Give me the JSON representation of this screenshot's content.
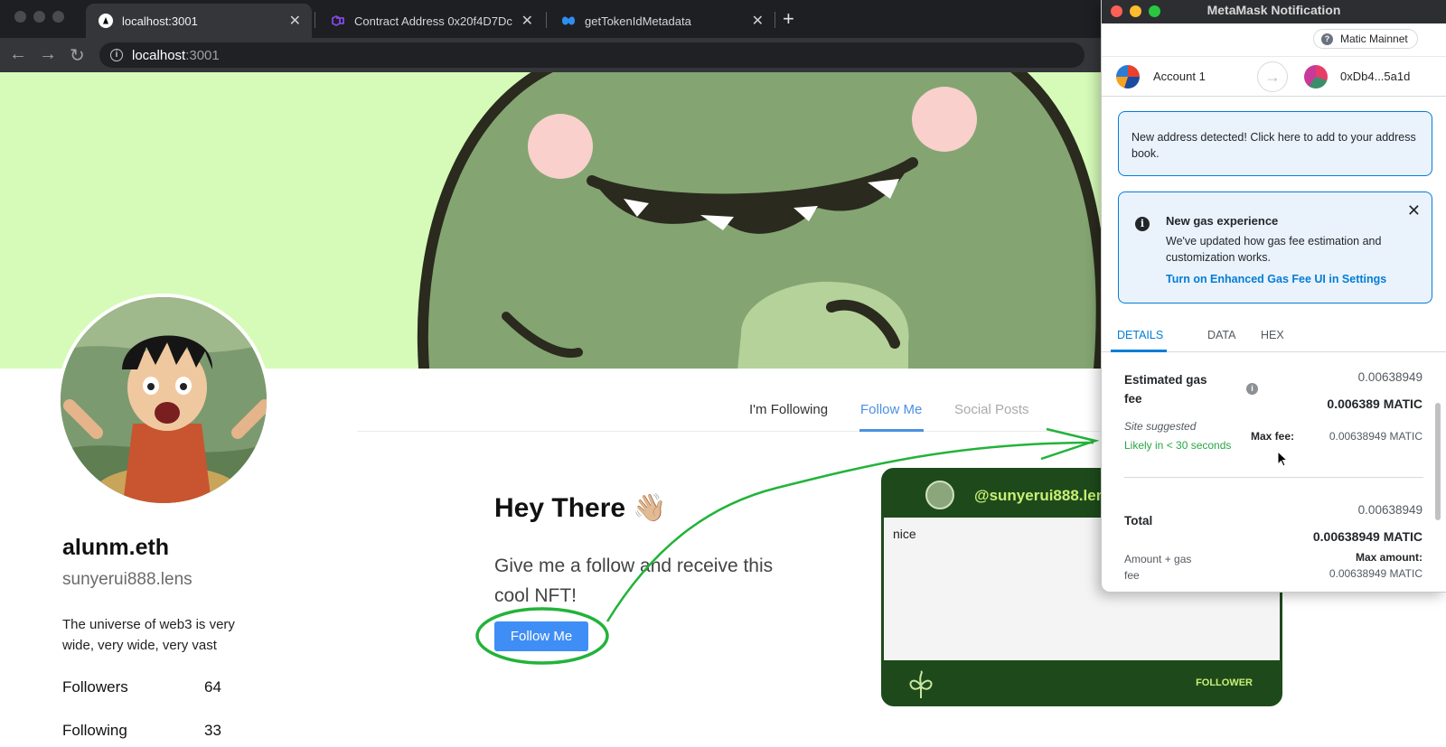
{
  "browser": {
    "tabs": [
      {
        "title": "localhost:3001",
        "close": "✕"
      },
      {
        "title": "Contract Address 0x20f4D7Dc",
        "close": "✕"
      },
      {
        "title": "getTokenIdMetadata",
        "close": "✕"
      }
    ],
    "new_tab": "+",
    "nav": {
      "back": "←",
      "forward": "→",
      "reload": "↻"
    },
    "url_host": "localhost",
    "url_port": ":3001",
    "url_info_icon": "i"
  },
  "profile": {
    "name": "alunm.eth",
    "handle": "sunyerui888.lens",
    "bio": "The universe of web3 is very wide, very wide, very vast",
    "stats": [
      {
        "label": "Followers",
        "value": "64"
      },
      {
        "label": "Following",
        "value": "33"
      }
    ]
  },
  "page_tabs": [
    "I'm Following",
    "Follow Me",
    "Social Posts"
  ],
  "hero": {
    "heading": "Hey There 👋🏼",
    "subtext": "Give me a follow and receive this cool NFT!",
    "button": "Follow Me"
  },
  "nft_card": {
    "handle": "@sunyerui888.lens",
    "text": "nice",
    "footer": "FOLLOWER"
  },
  "metamask": {
    "title": "MetaMask Notification",
    "network": "Matic Mainnet",
    "network_icon": "?",
    "account_from": "Account 1",
    "account_to": "0xDb4...5a1d",
    "arrow": "→",
    "address_alert": "New address detected! Click here to add to your address book.",
    "gas_alert": {
      "icon": "i",
      "title": "New gas experience",
      "body": "We've updated how gas fee estimation and customization works.",
      "link": "Turn on Enhanced Gas Fee UI in Settings",
      "close": "✕"
    },
    "detail_tabs": [
      "DETAILS",
      "DATA",
      "HEX"
    ],
    "estimated_fee": {
      "label": "Estimated gas fee",
      "info_icon": "i",
      "value_top": "0.00638949",
      "value_main": "0.006389 MATIC",
      "site_suggested": "Site suggested",
      "likely": "Likely in < 30 seconds",
      "max_fee_label": "Max fee:",
      "max_fee_value": "0.00638949 MATIC"
    },
    "total": {
      "label": "Total",
      "value_top": "0.00638949",
      "value_main": "0.00638949 MATIC",
      "sub_label": "Amount + gas fee",
      "max_amount_label": "Max amount:",
      "max_amount_value": "0.00638949 MATIC"
    }
  },
  "colors": {
    "accent_blue": "#3f8ef5",
    "banner_green": "#d6fbb8",
    "annotation_green": "#22b33a",
    "nft_dark_green": "#1e4a1b",
    "metamask_blue": "#037dd6",
    "likely_green": "#28a745"
  }
}
